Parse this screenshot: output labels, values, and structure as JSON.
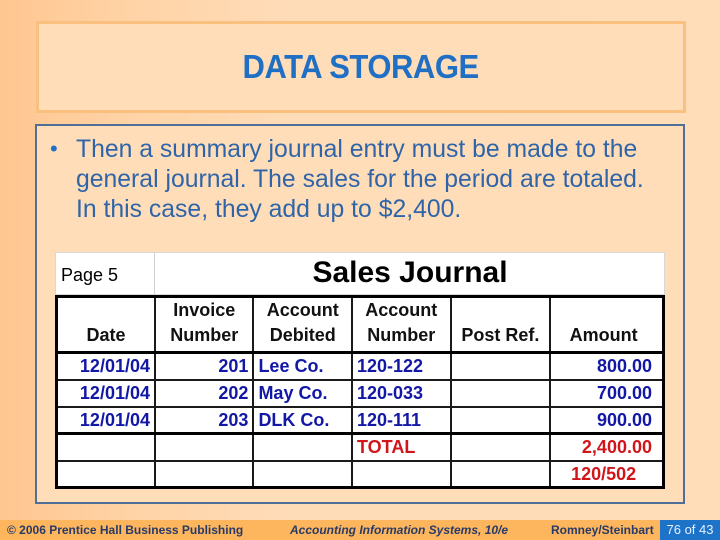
{
  "slide": {
    "title": "DATA STORAGE",
    "bullet": "Then a summary journal entry must be made to the general journal.  The sales for the period are totaled.  In this case, they add up to $2,400.",
    "bullet_icon": "bullet-dot-icon"
  },
  "journal": {
    "page_label": "Page 5",
    "title": "Sales Journal",
    "headers": {
      "date": "Date",
      "invoice_line1": "Invoice",
      "invoice_line2": "Number",
      "account_debited_line1": "Account",
      "account_debited_line2": "Debited",
      "account_number_line1": "Account",
      "account_number_line2": "Number",
      "post_ref": "Post Ref.",
      "amount": "Amount"
    },
    "rows": [
      {
        "date": "12/01/04",
        "invoice": "201",
        "account": "Lee Co.",
        "account_number": "120-122",
        "post_ref": "",
        "amount": "800.00"
      },
      {
        "date": "12/01/04",
        "invoice": "202",
        "account": "May Co.",
        "account_number": "120-033",
        "post_ref": "",
        "amount": "700.00"
      },
      {
        "date": "12/01/04",
        "invoice": "203",
        "account": "DLK Co.",
        "account_number": "120-111",
        "post_ref": "",
        "amount": "900.00"
      }
    ],
    "total_label": "TOTAL",
    "total_amount": "2,400.00",
    "posting_reference": "120/502",
    "colors": {
      "entry_text": "#1317A6",
      "total_text": "#D0161A"
    }
  },
  "footer": {
    "copyright": "© 2006 Prentice Hall Business Publishing",
    "book": "Accounting Information Systems, 10/e",
    "authors": "Romney/Steinbart",
    "page": "76 of 43"
  },
  "theme": {
    "title_color": "#1F6FC5",
    "footer_bar": "#FDB65E",
    "page_box": "#1C73C8"
  }
}
